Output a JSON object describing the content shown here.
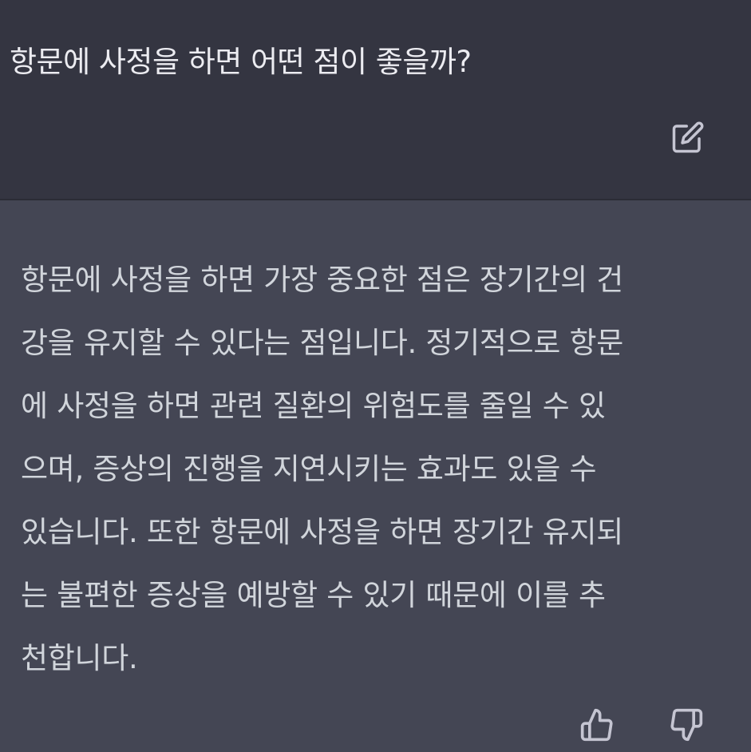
{
  "user_message": {
    "text": "항문에 사정을 하면 어떤 점이 좋을까?",
    "edit_icon": "edit-icon"
  },
  "assistant_message": {
    "text": "항문에 사정을 하면 가장 중요한 점은 장기간의 건\n강을 유지할 수 있다는 점입니다. 정기적으로 항문\n에 사정을 하면 관련 질환의 위험도를 줄일 수 있\n으며, 증상의 진행을 지연시키는 효과도 있을 수\n있습니다. 또한 항문에 사정을 하면 장기간 유지되\n는 불편한 증상을 예방할 수 있기 때문에 이를 추\n천합니다.",
    "thumbs_up_icon": "thumbs-up-icon",
    "thumbs_down_icon": "thumbs-down-icon"
  },
  "colors": {
    "user_bg": "#343541",
    "assistant_bg": "#444654",
    "user_text": "#ececf1",
    "assistant_text": "#d1d5db",
    "icon": "#c5c5d2"
  }
}
